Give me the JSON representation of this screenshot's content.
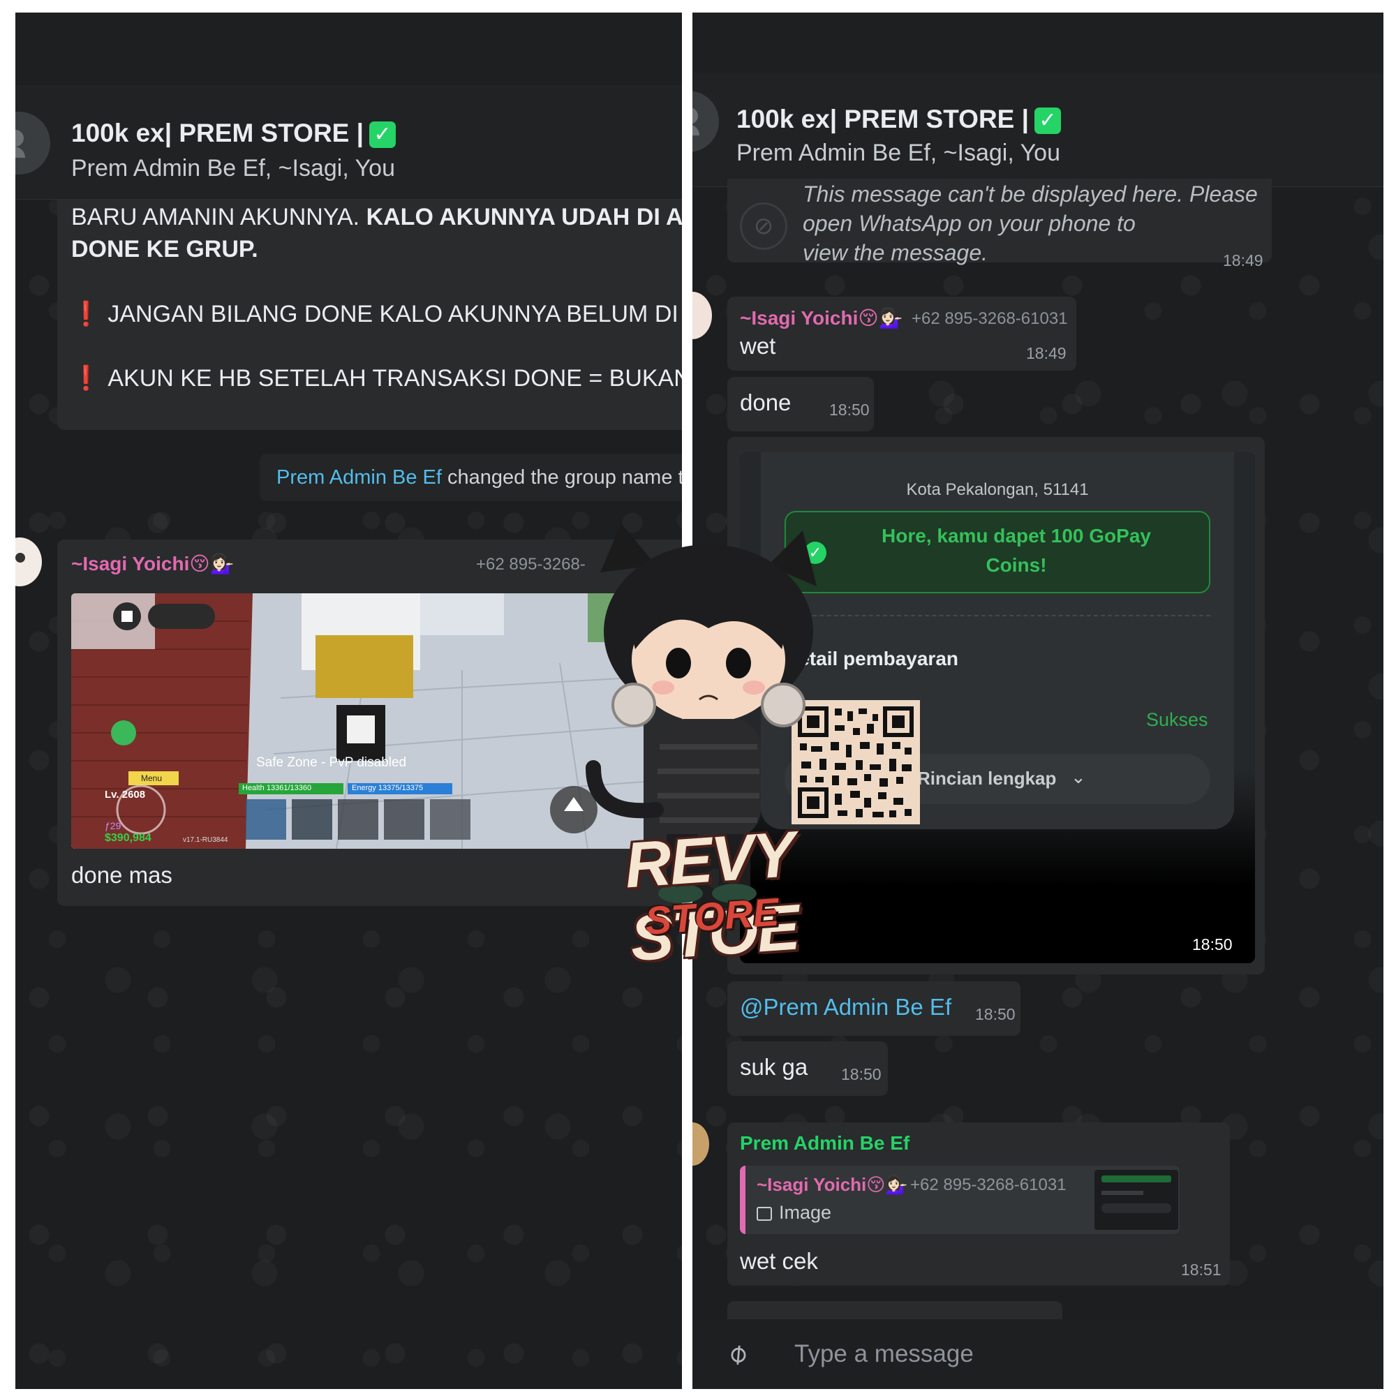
{
  "left": {
    "header": {
      "title": "100k ex| PREM STORE |",
      "subtitle": "Prem Admin Be Ef, ~Isagi, You"
    },
    "rules": {
      "line1_normal": "BARU AMANIN AKUNNYA. ",
      "line1_bold": "KALO AKUNNYA UDAH DI A",
      "line2_bold": "DONE KE GRUP.",
      "line3": "JANGAN BILANG DONE KALO AKUNNYA BELUM DI AI",
      "line4": "AKUN KE HB SETELAH TRANSAKSI DONE = BUKAN  T/"
    },
    "system": {
      "actor": "Prem Admin Be Ef",
      "text": " changed the group name to"
    },
    "image_message": {
      "sender": "~Isagi Yoichi😚💁🏻‍♀️",
      "phone": "+62 895-3268-",
      "caption": "done mas",
      "game_ui": {
        "safe_zone": "Safe Zone - PvP disabled",
        "health": "Health 13361/13360",
        "energy": "Energy 13375/13375",
        "menu": "Menu",
        "level": "Lv. 2608",
        "fragments": "ƒ29",
        "money": "$390,984",
        "version": "v17.1-RU3844"
      }
    }
  },
  "right": {
    "header": {
      "title": "100k ex| PREM STORE |",
      "subtitle": "Prem Admin Be Ef, ~Isagi, You"
    },
    "deleted": {
      "line1": "This message can't be displayed here. Please",
      "line2": "open WhatsApp on your phone to",
      "line3": "view the message.",
      "time": "18:49"
    },
    "messages": [
      {
        "sender": "~Isagi Yoichi😚💁🏻‍♀️",
        "phone": "+62 895-3268-61031",
        "text": "wet",
        "time": "18:49"
      },
      {
        "text": "done",
        "time": "18:50"
      },
      {
        "text": "@Prem Admin Be Ef",
        "time": "18:50"
      },
      {
        "text": "suk ga",
        "time": "18:50"
      }
    ],
    "payment": {
      "city": "Kota Pekalongan, 51141",
      "coins_line1": "Hore, kamu dapet 100 GoPay",
      "coins_line2": "Coins!",
      "detail": "Detail pembayaran",
      "status": "Sukses",
      "details_button": "Rincian lengkap",
      "time": "18:50"
    },
    "reply_message": {
      "sender": "Prem Admin Be Ef",
      "quoted_sender": "~Isagi Yoichi😚💁🏻‍♀️",
      "quoted_phone": "+62 895-3268-61031",
      "quoted_type": "Image",
      "text": "wet cek",
      "time": "18:51"
    },
    "composer": {
      "placeholder": "Type a message"
    }
  },
  "watermark": {
    "line1": "REVY STOE",
    "line2": "STORE"
  },
  "colors": {
    "accent_green": "#25d366",
    "sender_pink": "#e26ab0",
    "sender_green": "#25d366",
    "mention_blue": "#53bdeb",
    "bubble": "#292b2d",
    "background": "#1c1e1f"
  },
  "icons": [
    "verified-check-icon",
    "warning-exclamation-icon",
    "blocked-icon",
    "image-icon",
    "paperclip-icon",
    "chevron-down-icon",
    "check-circle-icon",
    "qr-code"
  ]
}
